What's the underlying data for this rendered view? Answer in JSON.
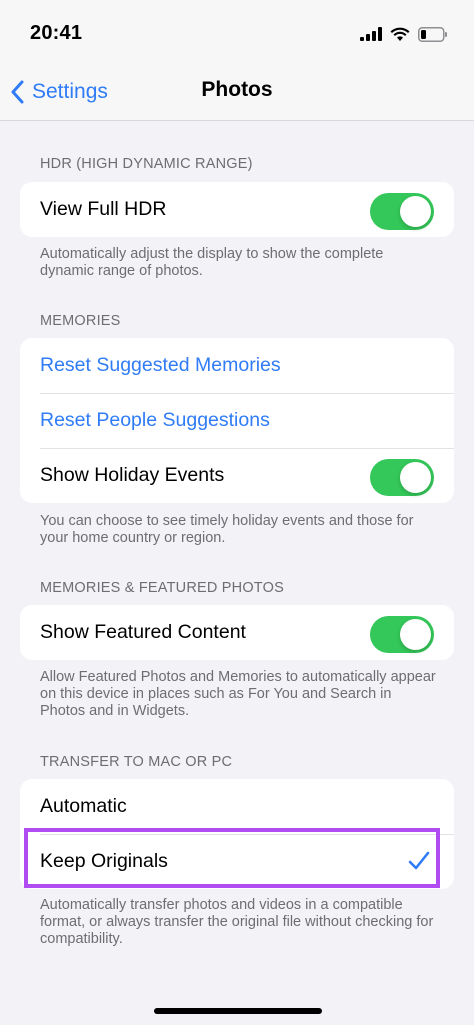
{
  "status_bar": {
    "time": "20:41"
  },
  "nav": {
    "back_label": "Settings",
    "title": "Photos"
  },
  "sections": {
    "hdr": {
      "header": "HDR (HIGH DYNAMIC RANGE)",
      "rows": [
        {
          "label": "View Full HDR",
          "toggle": true
        }
      ],
      "footer": "Automatically adjust the display to show the complete dynamic range of photos."
    },
    "memories": {
      "header": "MEMORIES",
      "rows": [
        {
          "label": "Reset Suggested Memories"
        },
        {
          "label": "Reset People Suggestions"
        },
        {
          "label": "Show Holiday Events",
          "toggle": true
        }
      ],
      "footer": "You can choose to see timely holiday events and those for your home country or region."
    },
    "featured": {
      "header": "MEMORIES & FEATURED PHOTOS",
      "rows": [
        {
          "label": "Show Featured Content",
          "toggle": true
        }
      ],
      "footer": "Allow Featured Photos and Memories to automatically appear on this device in places such as For You and Search in Photos and in Widgets."
    },
    "transfer": {
      "header": "TRANSFER TO MAC OR PC",
      "rows": [
        {
          "label": "Automatic",
          "selected": false
        },
        {
          "label": "Keep Originals",
          "selected": true
        }
      ],
      "footer": "Automatically transfer photos and videos in a compatible format, or always transfer the original file without checking for compatibility."
    }
  },
  "colors": {
    "accent": "#2f7cf6",
    "toggle_on": "#34c759",
    "highlight": "#b14cf2",
    "background": "#f2f2f7"
  }
}
